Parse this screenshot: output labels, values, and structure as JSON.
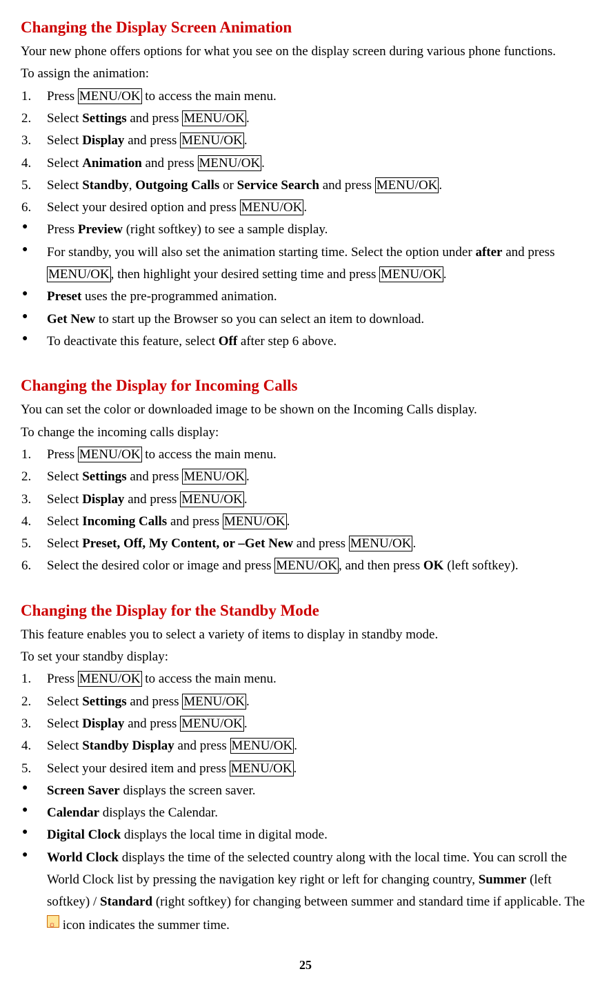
{
  "const": {
    "menuok": "MENU/OK",
    "accessMainMenu": " to access the main menu.",
    "press": "Press ",
    "select": "Select ",
    "andPress": " and press ",
    "settings": "Settings",
    "display": "Display",
    "period": "."
  },
  "section1": {
    "heading": "Changing the Display Screen Animation",
    "intro": "Your new phone offers options for what you see on the display screen during various phone functions.",
    "toLine": "To assign the animation:",
    "step4_opt": "Animation",
    "step5_pre": "Select ",
    "step5_o1": "Standby",
    "step5_c1": ", ",
    "step5_o2": "Outgoing Calls",
    "step5_c2": " or ",
    "step5_o3": "Service Search",
    "step6": "Select your desired option and press ",
    "b1_pre": "Press ",
    "b1_bold": "Preview",
    "b1_post": " (right softkey) to see a sample display.",
    "b2_pre": "For standby, you will also set the animation starting time. Select the option under ",
    "b2_bold": "after",
    "b2_mid": " and press ",
    "b2_mid2": ", then highlight your desired setting time and press ",
    "b3_bold": "Preset",
    "b3_post": " uses the pre-programmed animation.",
    "b4_bold": "Get New",
    "b4_post": " to start up the Browser so you can select an item to download.",
    "b5_pre": "To deactivate this feature, select ",
    "b5_bold": "Off",
    "b5_post": " after step 6 above."
  },
  "section2": {
    "heading": "Changing the Display for Incoming Calls",
    "intro": "You can set the color or downloaded image to be shown on the Incoming Calls display.",
    "toLine": "To change the incoming calls display:",
    "step4_opt": "Incoming Calls",
    "step5_bold": "Preset, Off, My Content, or –Get New",
    "step6_pre": "Select the desired color or image and press ",
    "step6_mid": ", and then press ",
    "step6_bold": "OK",
    "step6_post": " (left softkey)."
  },
  "section3": {
    "heading": "Changing the Display for the Standby Mode",
    "intro": "This feature enables you to select a variety of items to display in standby mode.",
    "toLine": "To set your standby display:",
    "step4_opt": "Standby Display",
    "step5": "Select your desired item and press ",
    "b1_bold": "Screen Saver",
    "b1_post": " displays the screen saver.",
    "b2_bold": "Calendar",
    "b2_post": " displays the Calendar.",
    "b3_bold": "Digital Clock",
    "b3_post": " displays the local time in digital mode.",
    "b4_bold": "World Clock",
    "b4_post1": " displays the time of the selected country along with the local time. You can scroll the World Clock list by pressing the navigation key right or left for changing country, ",
    "b4_bold2": "Summer",
    "b4_mid": " (left softkey) / ",
    "b4_bold3": "Standard",
    "b4_post2": " (right softkey) for changing between summer and standard time if applicable. The ",
    "b4_post3": " icon indicates the summer time."
  },
  "pageNumber": "25"
}
